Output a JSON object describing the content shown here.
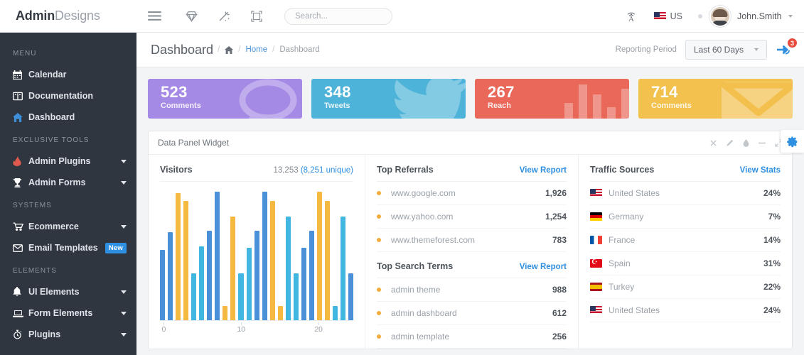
{
  "topbar": {
    "brand_bold": "Admin",
    "brand_light": "Designs",
    "menu_icon": "hamburger-icon",
    "icons": [
      "diamond-icon",
      "magic-wand-icon",
      "fullscreen-icon"
    ],
    "search_placeholder": "Search...",
    "broadcast_icon": "broadcast-icon",
    "language": "US",
    "username": "John.Smith"
  },
  "sidebar": {
    "groups": [
      {
        "heading": "MENU",
        "items": [
          {
            "label": "Calendar",
            "icon": "calendar-icon",
            "arrow": false,
            "badge": null,
            "accent": ""
          },
          {
            "label": "Documentation",
            "icon": "book-icon",
            "arrow": false,
            "badge": null,
            "accent": ""
          },
          {
            "label": "Dashboard",
            "icon": "home-icon",
            "arrow": false,
            "badge": null,
            "accent": "blue"
          }
        ]
      },
      {
        "heading": "EXCLUSIVE TOOLS",
        "items": [
          {
            "label": "Admin Plugins",
            "icon": "flame-icon",
            "arrow": true,
            "badge": null,
            "accent": "red"
          },
          {
            "label": "Admin Forms",
            "icon": "trophy-icon",
            "arrow": true,
            "badge": null,
            "accent": ""
          }
        ]
      },
      {
        "heading": "SYSTEMS",
        "items": [
          {
            "label": "Ecommerce",
            "icon": "cart-icon",
            "arrow": true,
            "badge": null,
            "accent": ""
          },
          {
            "label": "Email Templates",
            "icon": "envelope-icon",
            "arrow": false,
            "badge": "New",
            "accent": ""
          }
        ]
      },
      {
        "heading": "ELEMENTS",
        "items": [
          {
            "label": "UI Elements",
            "icon": "bell-icon",
            "arrow": true,
            "badge": null,
            "accent": ""
          },
          {
            "label": "Form Elements",
            "icon": "laptop-icon",
            "arrow": true,
            "badge": null,
            "accent": ""
          },
          {
            "label": "Plugins",
            "icon": "stopwatch-icon",
            "arrow": true,
            "badge": null,
            "accent": ""
          }
        ]
      }
    ]
  },
  "pagehead": {
    "title": "Dashboard",
    "breadcrumb": {
      "home_icon": "home-icon",
      "home": "Home",
      "current": "Dashboard",
      "sep": "/"
    },
    "reporting_label": "Reporting Period",
    "reporting_value": "Last 60 Days",
    "notification_count": "3",
    "notification_icon": "inbox-arrow-icon",
    "settings_icon": "gear-icon"
  },
  "cards": [
    {
      "value": "523",
      "label": "Comments",
      "color": "#a58ae5",
      "art": "speech-bubble-icon"
    },
    {
      "value": "348",
      "label": "Tweets",
      "color": "#4eb3d8",
      "art": "twitter-bird-icon"
    },
    {
      "value": "267",
      "label": "Reach",
      "color": "#e9685a",
      "art": "bar-graph-icon"
    },
    {
      "value": "714",
      "label": "Comments",
      "color": "#f3c14e",
      "art": "envelope-icon"
    }
  ],
  "panel": {
    "title": "Data Panel Widget",
    "tools": [
      "close-icon",
      "edit-icon",
      "color-icon",
      "minimize-icon",
      "expand-icon"
    ]
  },
  "visitors": {
    "title": "Visitors",
    "total": "13,253",
    "unique": "(8,251 unique)"
  },
  "referrals": {
    "title": "Top Referrals",
    "link": "View Report",
    "rows": [
      {
        "label": "www.google.com",
        "value": "1,926"
      },
      {
        "label": "www.yahoo.com",
        "value": "1,254"
      },
      {
        "label": "www.themeforest.com",
        "value": "783"
      }
    ]
  },
  "search_terms": {
    "title": "Top Search Terms",
    "link": "View Report",
    "rows": [
      {
        "label": "admin theme",
        "value": "988"
      },
      {
        "label": "admin dashboard",
        "value": "612"
      },
      {
        "label": "admin template",
        "value": "256"
      }
    ]
  },
  "traffic": {
    "title": "Traffic Sources",
    "link": "View Stats",
    "rows": [
      {
        "label": "United States",
        "value": "24%",
        "flag": "us"
      },
      {
        "label": "Germany",
        "value": "7%",
        "flag": "de"
      },
      {
        "label": "France",
        "value": "14%",
        "flag": "fr"
      },
      {
        "label": "Spain",
        "value": "31%",
        "flag": "tr"
      },
      {
        "label": "Turkey",
        "value": "22%",
        "flag": "es"
      },
      {
        "label": "United States",
        "value": "24%",
        "flag": "us"
      }
    ]
  },
  "chart_data": {
    "type": "bar",
    "title": "Visitors",
    "xlabel": "",
    "ylabel": "",
    "xticks": [
      0,
      10,
      20
    ],
    "ylim": [
      0,
      100
    ],
    "grid": false,
    "legend": null,
    "colors": {
      "blue": "#4a90d9",
      "orange": "#f5b942",
      "lightblue": "#41b6e0"
    },
    "x": [
      0,
      1,
      2,
      3,
      4,
      5,
      6,
      7,
      8,
      9,
      10,
      11,
      12,
      13,
      14,
      15,
      16,
      17,
      18,
      19,
      20,
      21,
      22,
      23,
      24
    ],
    "values": [
      54,
      68,
      98,
      92,
      36,
      57,
      69,
      99,
      11,
      80,
      36,
      56,
      69,
      99,
      92,
      11,
      80,
      36,
      56,
      69,
      99,
      92,
      11,
      80,
      36
    ],
    "series_colors": [
      "blue",
      "blue",
      "orange",
      "orange",
      "lightblue",
      "lightblue",
      "blue",
      "blue",
      "orange",
      "orange",
      "lightblue",
      "lightblue",
      "blue",
      "blue",
      "orange",
      "orange",
      "lightblue",
      "lightblue",
      "blue",
      "blue",
      "orange",
      "orange",
      "lightblue",
      "lightblue",
      "blue"
    ]
  }
}
